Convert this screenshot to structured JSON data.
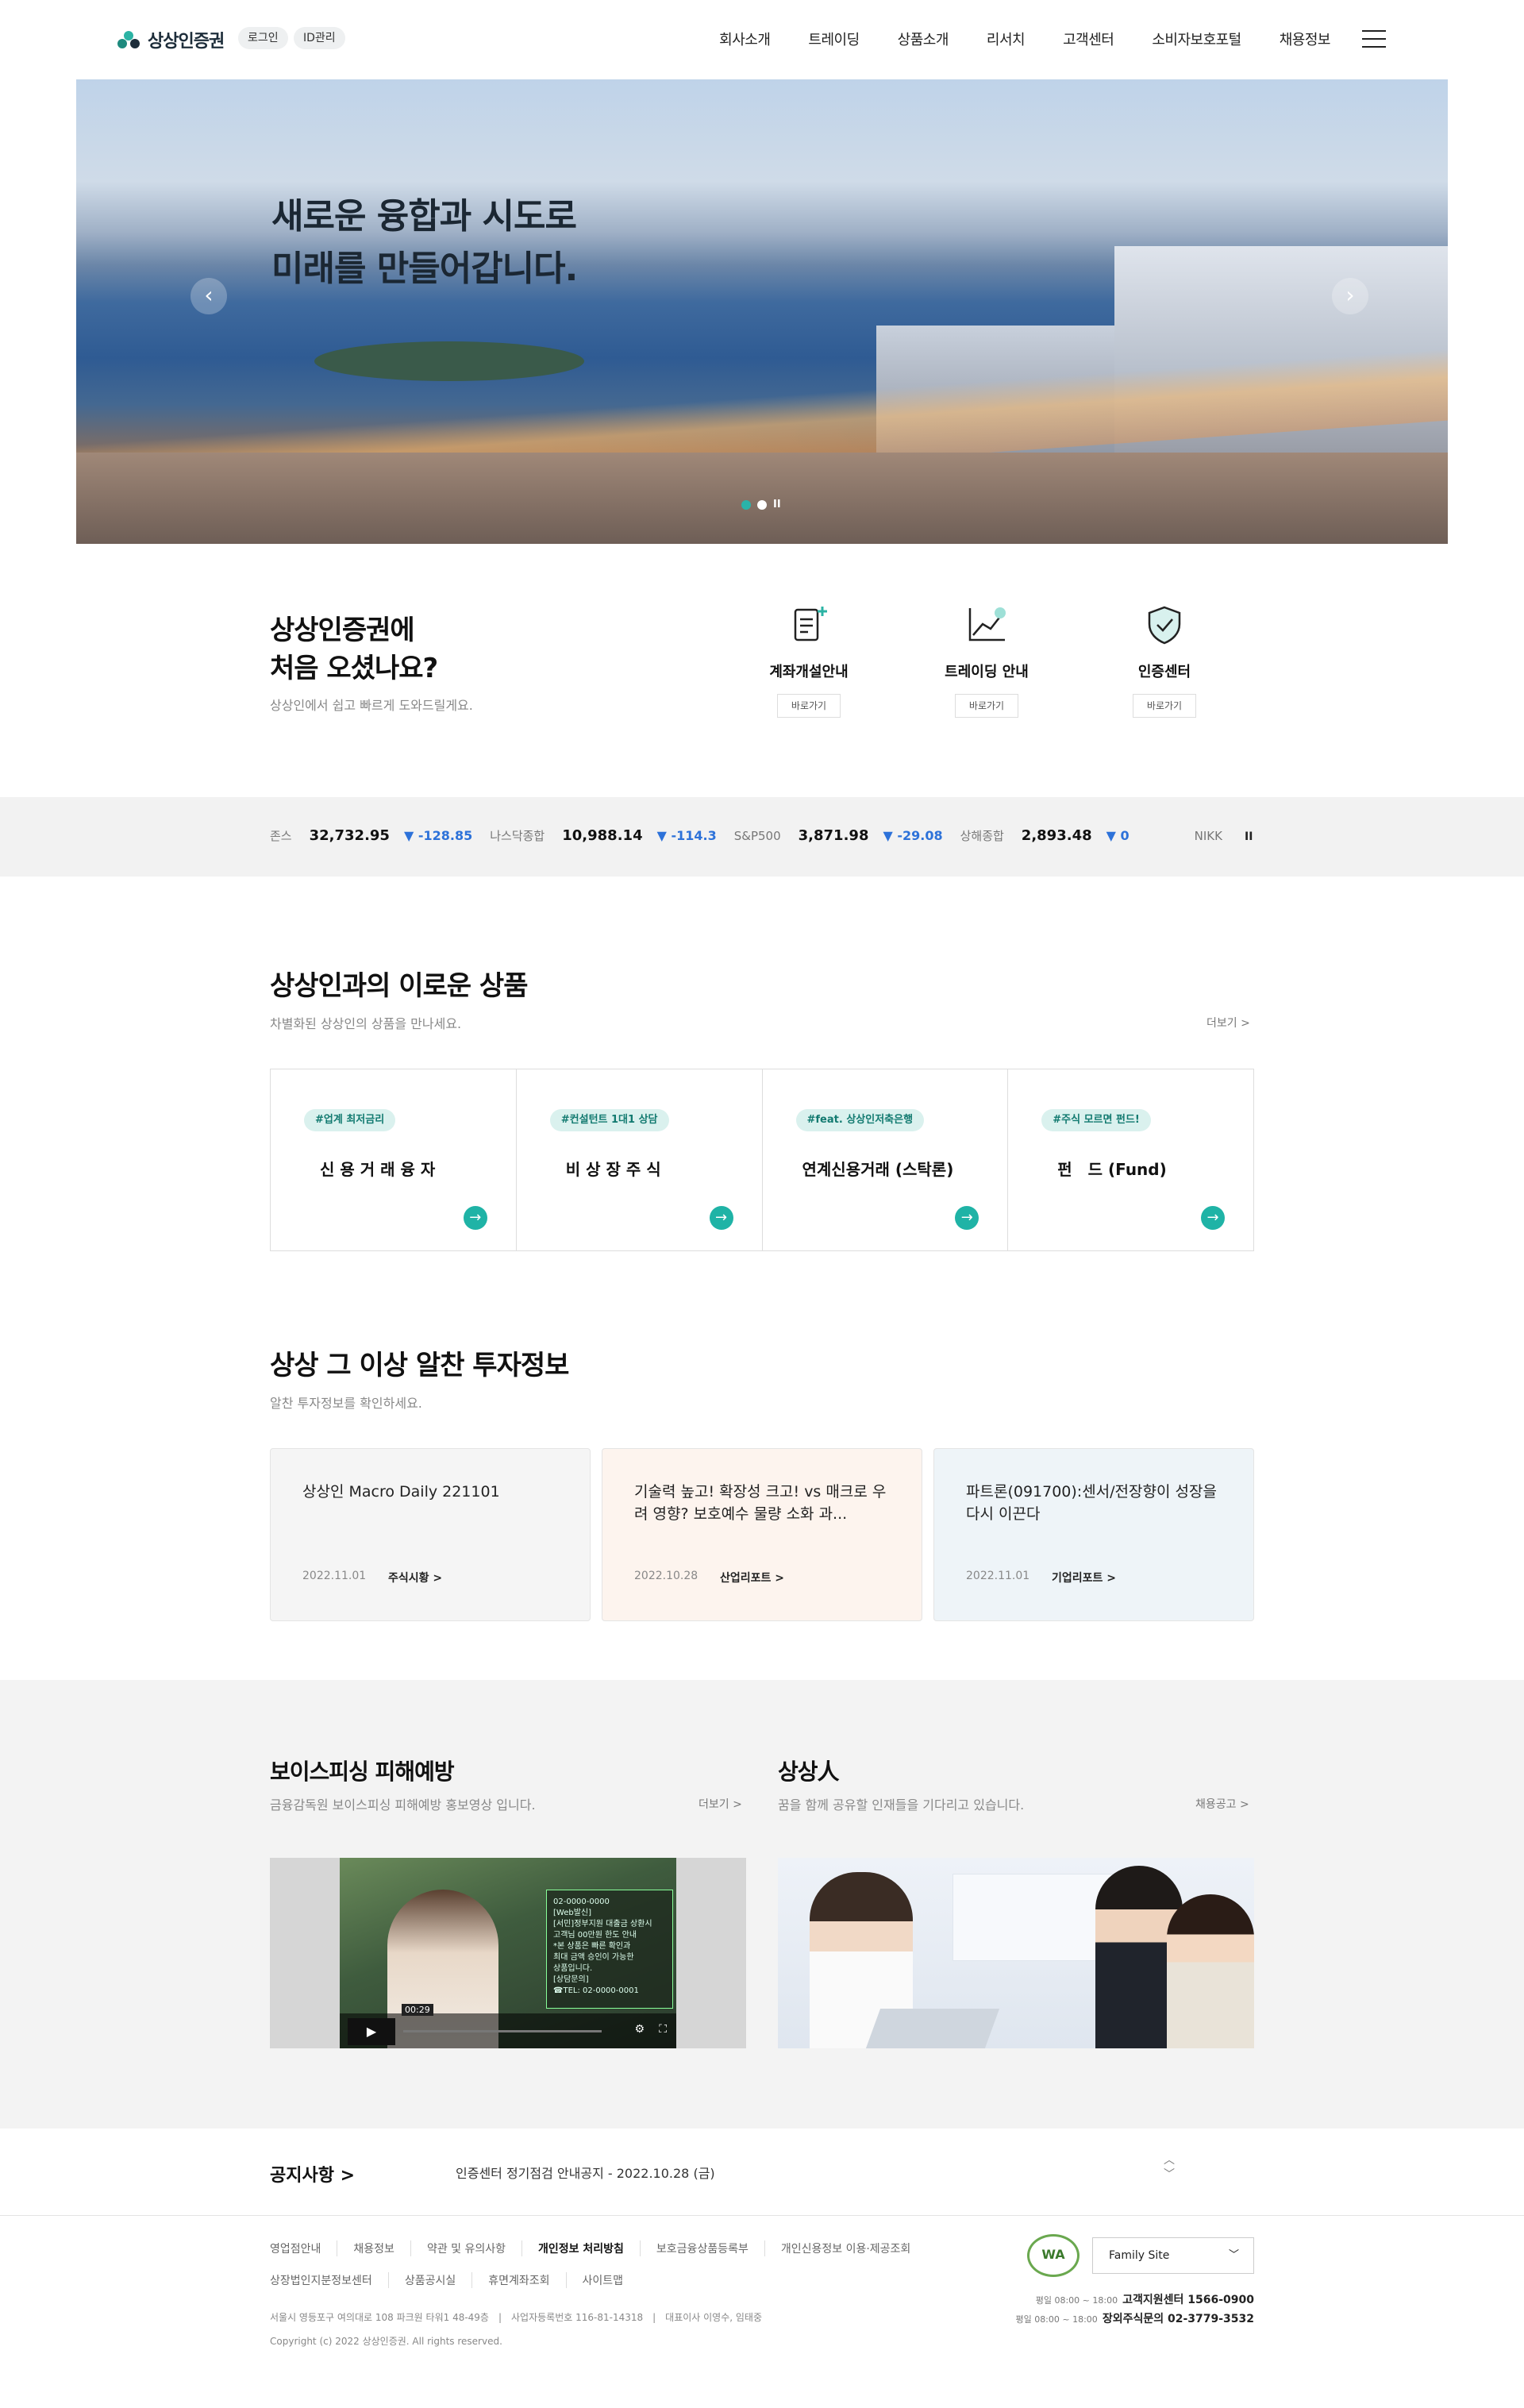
{
  "header": {
    "brand": "상상인증권",
    "login": "로그인",
    "id_manage": "ID관리",
    "nav": [
      "회사소개",
      "트레이딩",
      "상품소개",
      "리서치",
      "고객센터",
      "소비자보호포털",
      "채용정보"
    ]
  },
  "hero": {
    "title": "새로운 융합과 시도로\n미래를 만들어갑니다.",
    "pause": "II"
  },
  "first_visit": {
    "title": "상상인증권에\n처음 오셨나요?",
    "subtitle": "상상인에서 쉽고 빠르게 도와드릴게요.",
    "items": [
      {
        "label": "계좌개설안내",
        "button": "바로가기",
        "icon": "document-plus-icon"
      },
      {
        "label": "트레이딩 안내",
        "button": "바로가기",
        "icon": "chart-line-icon"
      },
      {
        "label": "인증센터",
        "button": "바로가기",
        "icon": "shield-check-icon"
      }
    ]
  },
  "ticker": {
    "items": [
      {
        "name": "존스",
        "value": "32,732.95",
        "change": "-128.85"
      },
      {
        "name": "나스닥종합",
        "value": "10,988.14",
        "change": "-114.3"
      },
      {
        "name": "S&P500",
        "value": "3,871.98",
        "change": "-29.08"
      },
      {
        "name": "상해종합",
        "value": "2,893.48",
        "change": "0"
      },
      {
        "name": "NIKK",
        "value": "",
        "change": ""
      }
    ],
    "pause": "II",
    "down_color": "#2d72d9"
  },
  "products": {
    "title": "상상인과의 이로운 상품",
    "subtitle": "차별화된 상상인의 상품을 만나세요.",
    "more": "더보기 >",
    "items": [
      {
        "tag": "#업계 최저금리",
        "name": "신 용 거 래 융 자"
      },
      {
        "tag": "#컨설턴트 1대1 상담",
        "name": "비 상 장 주 식"
      },
      {
        "tag": "#feat. 상상인저축은행",
        "name": "연계신용거래 (스탁론)"
      },
      {
        "tag": "#주식 모르면 펀드!",
        "name": "펀　드 (Fund)"
      }
    ],
    "accent": "#1fb3a6"
  },
  "insight": {
    "title": "상상 그 이상 알찬 투자정보",
    "subtitle": "알찬 투자정보를 확인하세요.",
    "cards": [
      {
        "title": "상상인 Macro Daily 221101",
        "date": "2022.11.01",
        "category": "주식시황 >",
        "bg": "#f5f5f5"
      },
      {
        "title": "기술력 높고! 확장성 크고! vs 매크로 우려 영향? 보호예수 물량 소화 과...",
        "date": "2022.10.28",
        "category": "산업리포트 >",
        "bg": "#fdf4ee"
      },
      {
        "title": "파트론(091700):센서/전장향이 성장을 다시 이끈다",
        "date": "2022.11.01",
        "category": "기업리포트 >",
        "bg": "#eef4f8"
      }
    ]
  },
  "voice": {
    "title": "보이스피싱 피해예방",
    "subtitle": "금융감독원 보이스피싱 피해예방 홍보영상 입니다.",
    "more": "더보기 >",
    "video_note": "02-0000-0000\n[Web발신]\n[서민]정부지원 대출금 상환시\n고객님 00만원 한도 안내\n*본 상품은 빠른 확인과\n최대 금액 승인이 가능한\n상품입니다.\n[상담문의]\n☎TEL: 02-0000-0001",
    "time": "00:29"
  },
  "people": {
    "title": "상상人",
    "subtitle": "꿈을 함께 공유할 인재들을 기다리고 있습니다.",
    "more": "채용공고 >"
  },
  "notice": {
    "label": "공지사항 >",
    "text": "인증센터 정기점검 안내공지 - 2022.10.28 (금)",
    "up": "︿",
    "down": "﹀"
  },
  "footer": {
    "links_row1": [
      "영업점안내",
      "채용정보",
      "약관 및 유의사항",
      "개인정보 처리방침",
      "보호금융상품등록부",
      "개인신용정보 이용·제공조회"
    ],
    "links_row2": [
      "상장법인지분정보센터",
      "상품공시실",
      "휴면계좌조회",
      "사이트맵"
    ],
    "address": "서울시 영등포구 여의대로 108 파크원 타워1 48-49층　|　사업자등록번호 116-81-14318　|　대표이사 이영수, 임태중",
    "copyright": "Copyright (c) 2022 상상인증권. All rights reserved.",
    "wa_mark": "WA",
    "family_site": "Family Site",
    "cs1_hours": "평일 08:00 ~ 18:00",
    "cs1_label": "고객지원센터 1566-0900",
    "cs2_hours": "평일 08:00 ~ 18:00",
    "cs2_label": "장외주식문의 02-3779-3532"
  }
}
